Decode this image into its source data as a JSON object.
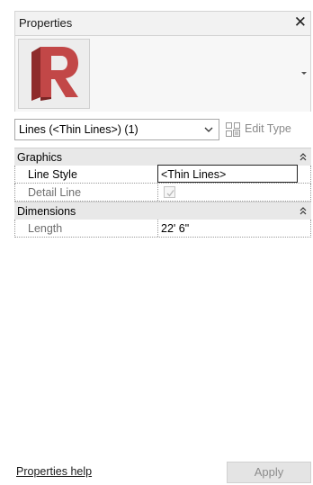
{
  "window": {
    "title": "Properties",
    "close_symbol": "✕"
  },
  "type_selector": {
    "selected": "Lines (<Thin Lines>) (1)",
    "edit_type_label": "Edit Type"
  },
  "groups": [
    {
      "name": "Graphics",
      "properties": [
        {
          "name": "Line Style",
          "value": "<Thin Lines>",
          "editing": true
        },
        {
          "name": "Detail Line",
          "value_type": "checkbox",
          "checked": true,
          "disabled": true
        }
      ]
    },
    {
      "name": "Dimensions",
      "properties": [
        {
          "name": "Length",
          "value": "22'  6\""
        }
      ]
    }
  ],
  "footer": {
    "help_link": "Properties help",
    "apply_label": "Apply"
  },
  "colors": {
    "group_bg": "#e8e8e8",
    "logo_red": "#b53a3a",
    "disabled_text": "#8c8c8c"
  },
  "icons": [
    "revit-logo-icon",
    "dropdown-arrow-icon",
    "chevron-down-icon",
    "edit-type-icon",
    "collapse-icon",
    "checkmark-icon"
  ]
}
